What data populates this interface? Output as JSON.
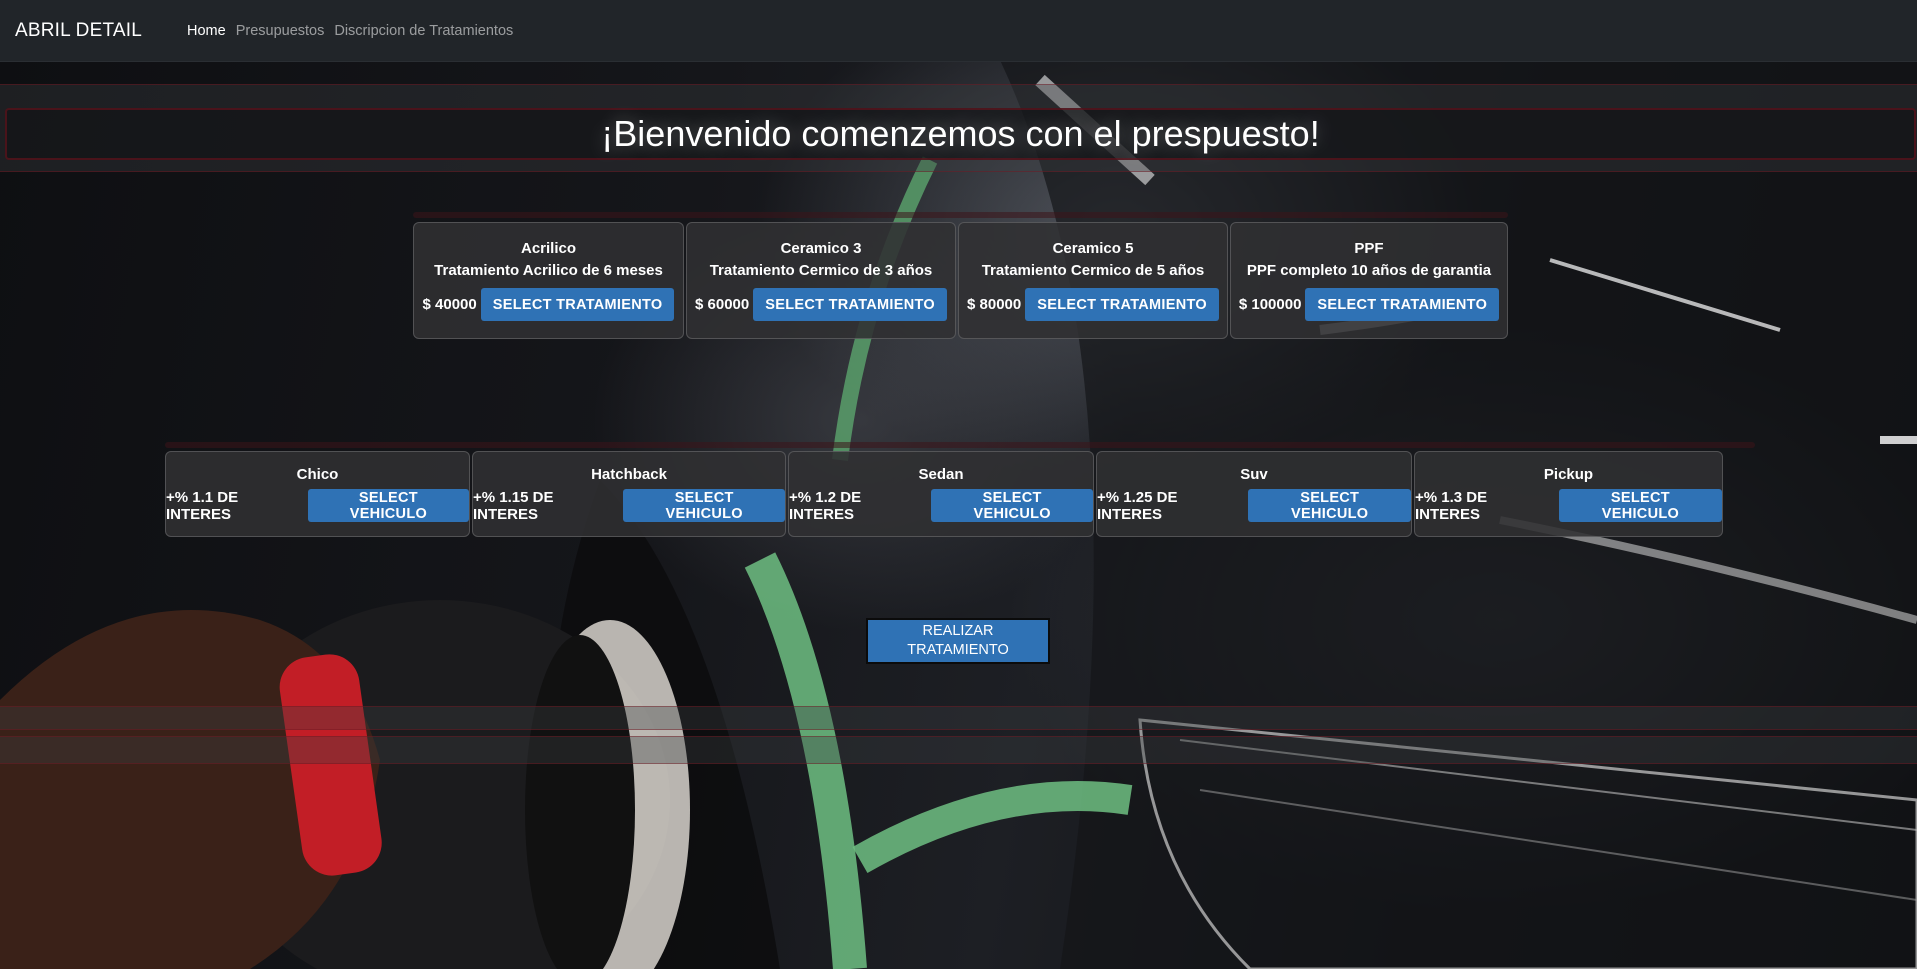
{
  "navbar": {
    "brand": "ABRIL DETAIL",
    "links": [
      "Home",
      "Presupuestos",
      "Discripcion de Tratamientos"
    ]
  },
  "hero": {
    "title": "¡Bienvenido comenzemos con el prespuesto!"
  },
  "tratamientos": [
    {
      "name": "Acrilico",
      "desc": "Tratamiento Acrilico de 6 meses",
      "price": "$ 40000",
      "button": "SELECT TRATAMIENTO"
    },
    {
      "name": "Ceramico 3",
      "desc": "Tratamiento Cermico de 3 años",
      "price": "$ 60000",
      "button": "SELECT TRATAMIENTO"
    },
    {
      "name": "Ceramico 5",
      "desc": "Tratamiento Cermico de 5 años",
      "price": "$ 80000",
      "button": "SELECT TRATAMIENTO"
    },
    {
      "name": "PPF",
      "desc": "PPF completo 10 años de garantia",
      "price": "$ 100000",
      "button": "SELECT TRATAMIENTO"
    }
  ],
  "vehiculos": [
    {
      "name": "Chico",
      "interest": "+% 1.1 DE INTERES",
      "button": "SELECT VEHICULO"
    },
    {
      "name": "Hatchback",
      "interest": "+% 1.15 DE INTERES",
      "button": "SELECT VEHICULO"
    },
    {
      "name": "Sedan",
      "interest": "+% 1.2 DE INTERES",
      "button": "SELECT VEHICULO"
    },
    {
      "name": "Suv",
      "interest": "+% 1.25 DE INTERES",
      "button": "SELECT VEHICULO"
    },
    {
      "name": "Pickup",
      "interest": "+% 1.3 DE INTERES",
      "button": "SELECT VEHICULO"
    }
  ],
  "action": {
    "line1": "REALIZAR",
    "line2": "TRATAMIENTO"
  },
  "colors": {
    "navbar": "#212529",
    "button": "#2f72b5",
    "card": "#303032",
    "accent_strip": "#6e121c"
  }
}
